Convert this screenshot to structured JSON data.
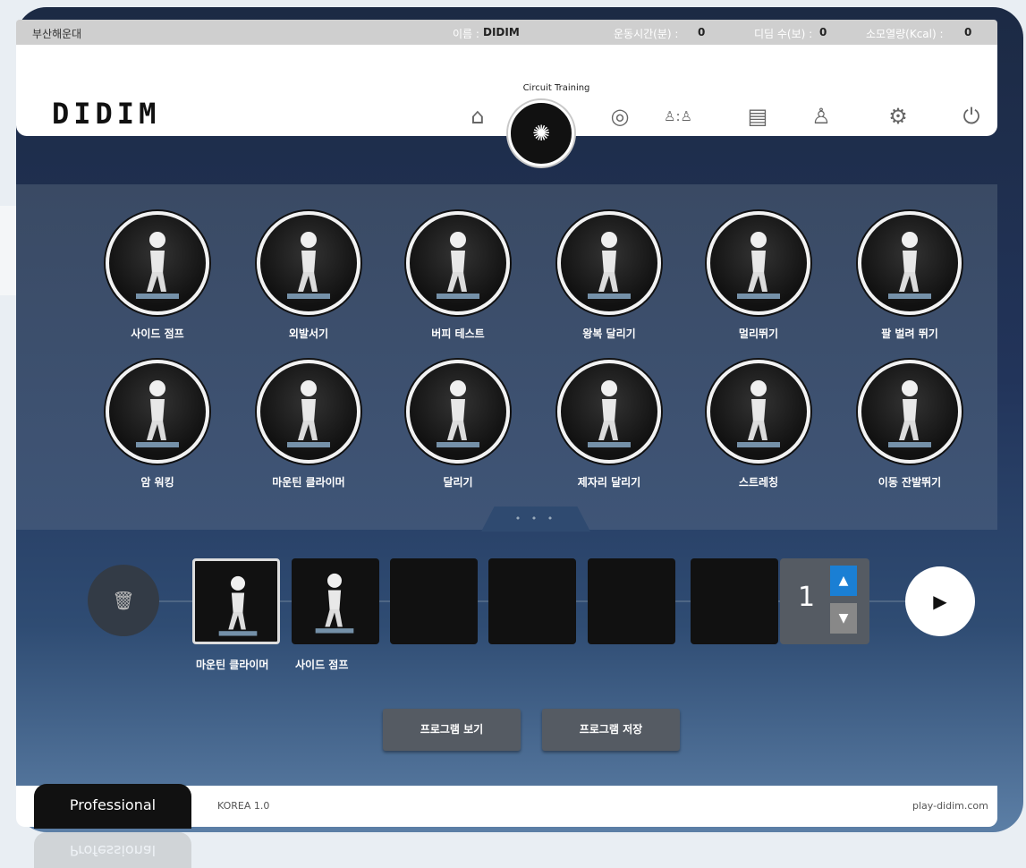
{
  "status_bar": {
    "location": "부산해운대",
    "name_label": "이름 :",
    "name_value": "DIDIM",
    "exercise_time_label": "운동시간(분) :",
    "exercise_time_value": "0",
    "steps_label": "디딤 수(보) :",
    "steps_value": "0",
    "calories_label": "소모열량(Kcal) :",
    "calories_value": "0"
  },
  "header": {
    "logo": "DIDIM",
    "active_caption": "Circuit Training",
    "icons": [
      "home-icon",
      "circuit-training-icon",
      "target-icon",
      "versus-icon",
      "report-icon",
      "walking-icon",
      "settings-icon",
      "power-icon"
    ]
  },
  "exercises": [
    {
      "label": "사이드 점프"
    },
    {
      "label": "외발서기"
    },
    {
      "label": "버피 테스트"
    },
    {
      "label": "왕복 달리기"
    },
    {
      "label": "멀리뛰기"
    },
    {
      "label": "팔 벌려 뛰기"
    },
    {
      "label": "암 워킹"
    },
    {
      "label": "마운틴 클라이머"
    },
    {
      "label": "달리기"
    },
    {
      "label": "제자리 달리기"
    },
    {
      "label": "스트레칭"
    },
    {
      "label": "이동 잔발뛰기"
    }
  ],
  "pager": {
    "dots": "• • •"
  },
  "sequence": {
    "slots": [
      {
        "label": "마운틴 클라이머",
        "selected": true
      },
      {
        "label": "사이드 점프",
        "selected": false
      },
      {
        "label": "",
        "selected": false
      },
      {
        "label": "",
        "selected": false
      },
      {
        "label": "",
        "selected": false
      },
      {
        "label": "",
        "selected": false
      }
    ],
    "repeat_count": "1"
  },
  "buttons": {
    "view_program": "프로그램 보기",
    "save_program": "프로그램 저장"
  },
  "footer": {
    "edition": "Professional",
    "version": "KOREA 1.0",
    "website": "play-didim.com"
  },
  "colors": {
    "accent_blue": "#1a7fd4",
    "panel": "#3f5577",
    "header_bg": "#ffffff"
  }
}
